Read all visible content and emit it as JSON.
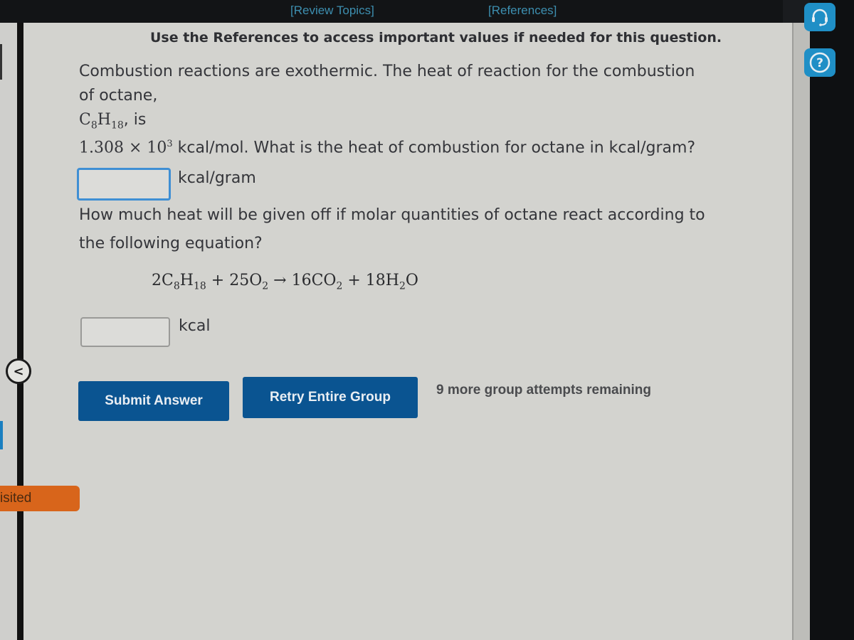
{
  "header": {
    "review_topics_link": "[Review Topics]",
    "references_link": "[References]"
  },
  "question": {
    "instruction": "Use the References to access important values if needed for this question.",
    "part1": {
      "line1": "Combustion reactions are exothermic. The heat of reaction for the combustion",
      "line2": "of octane,",
      "formula_c": "C",
      "formula_c_sub": "8",
      "formula_h": "H",
      "formula_h_sub": "18",
      "formula_suffix": ", is",
      "value_mantissa": "1.308 × 10",
      "value_exponent": "3",
      "value_suffix": " kcal/mol. What is the heat of combustion for octane in kcal/gram?",
      "answer_value": "",
      "unit": "kcal/gram"
    },
    "part2": {
      "line1": "How much heat will be given off if molar quantities of octane react according to",
      "line2": "the following equation?",
      "equation": {
        "t1": "2C",
        "s1": "8",
        "t2": "H",
        "s2": "18",
        "t3": " + 25O",
        "s3": "2",
        "arrow": " → ",
        "t4": "16CO",
        "s4": "2",
        "t5": " + 18H",
        "s5": "2",
        "t6": "O"
      },
      "answer_value": "",
      "unit": "kcal"
    }
  },
  "actions": {
    "submit_label": "Submit Answer",
    "retry_label": "Retry Entire Group",
    "attempts_text": "9 more group attempts remaining"
  },
  "sidebar": {
    "collapse_glyph": "<",
    "visited_label": "isited"
  },
  "side_tools": {
    "support_icon": "headset-icon",
    "help_icon": "help-circle-icon"
  },
  "colors": {
    "button_blue": "#0a5491",
    "link_teal": "#3d8fb0",
    "focus_blue": "#3f8fd4",
    "visited_orange": "#d8651b",
    "tool_blue": "#1f8fc6"
  }
}
